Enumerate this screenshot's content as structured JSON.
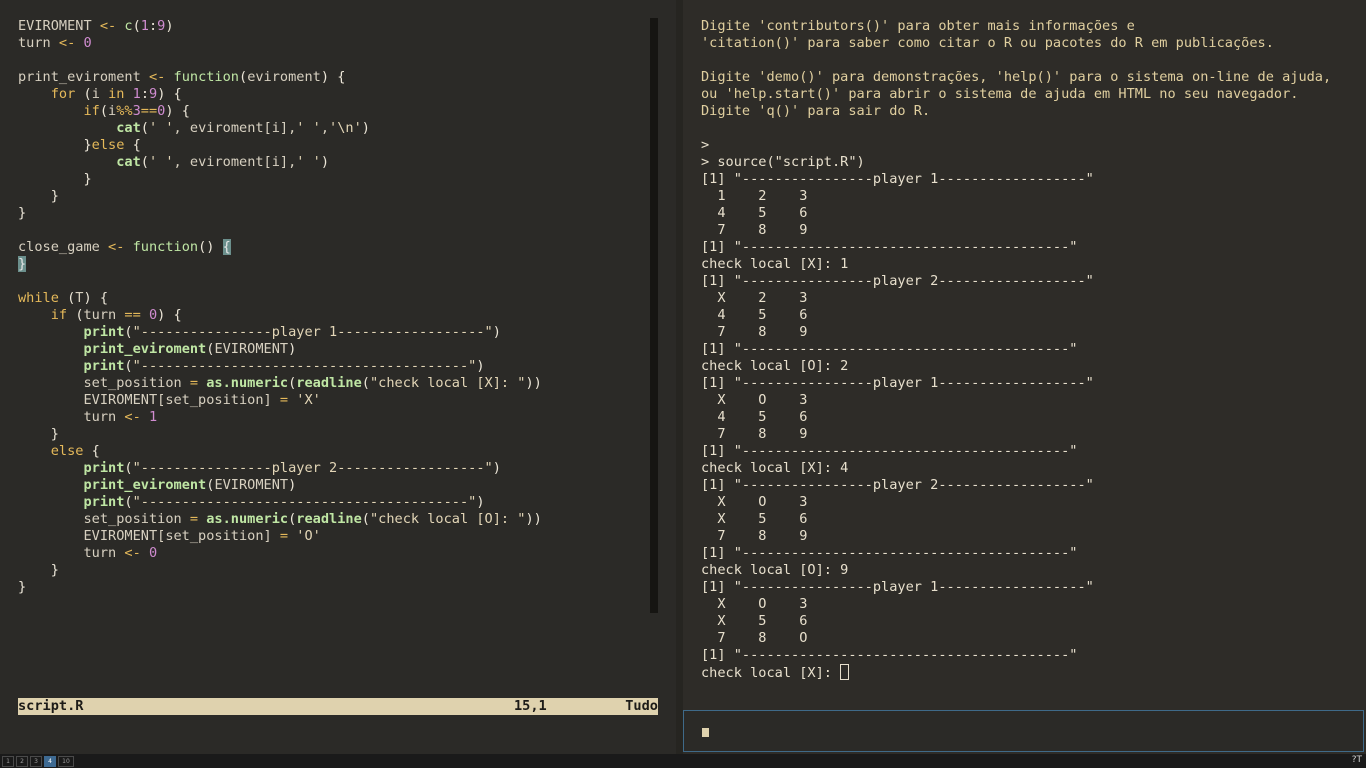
{
  "editor": {
    "code_lines": [
      [
        [
          "var",
          "EVIROMENT "
        ],
        [
          "op",
          "<- "
        ],
        [
          "fn",
          "c"
        ],
        [
          "br",
          "("
        ],
        [
          "num",
          "1"
        ],
        [
          "br",
          ":"
        ],
        [
          "num",
          "9"
        ],
        [
          "br",
          ")"
        ]
      ],
      [
        [
          "var",
          "turn "
        ],
        [
          "op",
          "<- "
        ],
        [
          "num",
          "0"
        ]
      ],
      [],
      [
        [
          "var",
          "print_eviroment "
        ],
        [
          "op",
          "<- "
        ],
        [
          "fn",
          "function"
        ],
        [
          "br",
          "("
        ],
        [
          "var",
          "eviroment"
        ],
        [
          "br",
          ") {"
        ]
      ],
      [
        [
          "var",
          "    "
        ],
        [
          "kw",
          "for "
        ],
        [
          "br",
          "("
        ],
        [
          "var",
          "i "
        ],
        [
          "kw",
          "in "
        ],
        [
          "num",
          "1"
        ],
        [
          "br",
          ":"
        ],
        [
          "num",
          "9"
        ],
        [
          "br",
          ") {"
        ]
      ],
      [
        [
          "var",
          "        "
        ],
        [
          "kw",
          "if"
        ],
        [
          "br",
          "("
        ],
        [
          "var",
          "i"
        ],
        [
          "op",
          "%%"
        ],
        [
          "num",
          "3"
        ],
        [
          "op",
          "=="
        ],
        [
          "num",
          "0"
        ],
        [
          "br",
          ") {"
        ]
      ],
      [
        [
          "var",
          "            "
        ],
        [
          "bfn",
          "cat"
        ],
        [
          "br",
          "("
        ],
        [
          "str",
          "' '"
        ],
        [
          "var",
          ", eviroment[i],"
        ],
        [
          "str",
          "' '"
        ],
        [
          "var",
          ","
        ],
        [
          "str",
          "'\\n'"
        ],
        [
          "br",
          ")"
        ]
      ],
      [
        [
          "var",
          "        "
        ],
        [
          "br",
          "}"
        ],
        [
          "kw",
          "else "
        ],
        [
          "br",
          "{"
        ]
      ],
      [
        [
          "var",
          "            "
        ],
        [
          "bfn",
          "cat"
        ],
        [
          "br",
          "("
        ],
        [
          "str",
          "' '"
        ],
        [
          "var",
          ", eviroment[i],"
        ],
        [
          "str",
          "' '"
        ],
        [
          "br",
          ")"
        ]
      ],
      [
        [
          "var",
          "        "
        ],
        [
          "br",
          "}"
        ]
      ],
      [
        [
          "var",
          "    "
        ],
        [
          "br",
          "}"
        ]
      ],
      [
        [
          "br",
          "}"
        ]
      ],
      [],
      [
        [
          "var",
          "close_game "
        ],
        [
          "op",
          "<- "
        ],
        [
          "fn",
          "function"
        ],
        [
          "br",
          "() "
        ],
        [
          "hl",
          "{"
        ]
      ],
      [
        [
          "hl",
          "}"
        ]
      ],
      [],
      [
        [
          "kw",
          "while "
        ],
        [
          "br",
          "("
        ],
        [
          "var",
          "T"
        ],
        [
          "br",
          ") {"
        ]
      ],
      [
        [
          "var",
          "    "
        ],
        [
          "kw",
          "if "
        ],
        [
          "br",
          "("
        ],
        [
          "var",
          "turn "
        ],
        [
          "op",
          "== "
        ],
        [
          "num",
          "0"
        ],
        [
          "br",
          ") {"
        ]
      ],
      [
        [
          "var",
          "        "
        ],
        [
          "bfn",
          "print"
        ],
        [
          "br",
          "("
        ],
        [
          "str",
          "\"----------------player 1------------------\""
        ],
        [
          "br",
          ")"
        ]
      ],
      [
        [
          "var",
          "        "
        ],
        [
          "bfn",
          "print_eviroment"
        ],
        [
          "br",
          "("
        ],
        [
          "var",
          "EVIROMENT"
        ],
        [
          "br",
          ")"
        ]
      ],
      [
        [
          "var",
          "        "
        ],
        [
          "bfn",
          "print"
        ],
        [
          "br",
          "("
        ],
        [
          "str",
          "\"----------------------------------------\""
        ],
        [
          "br",
          ")"
        ]
      ],
      [
        [
          "var",
          "        set_position "
        ],
        [
          "op",
          "= "
        ],
        [
          "bfn",
          "as.numeric"
        ],
        [
          "br",
          "("
        ],
        [
          "bfn",
          "readline"
        ],
        [
          "br",
          "("
        ],
        [
          "str",
          "\"check local [X]: \""
        ],
        [
          "br",
          "))"
        ]
      ],
      [
        [
          "var",
          "        EVIROMENT[set_position] "
        ],
        [
          "op",
          "= "
        ],
        [
          "str",
          "'X'"
        ]
      ],
      [
        [
          "var",
          "        turn "
        ],
        [
          "op",
          "<- "
        ],
        [
          "num",
          "1"
        ]
      ],
      [
        [
          "var",
          "    "
        ],
        [
          "br",
          "}"
        ]
      ],
      [
        [
          "var",
          "    "
        ],
        [
          "kw",
          "else "
        ],
        [
          "br",
          "{"
        ]
      ],
      [
        [
          "var",
          "        "
        ],
        [
          "bfn",
          "print"
        ],
        [
          "br",
          "("
        ],
        [
          "str",
          "\"----------------player 2------------------\""
        ],
        [
          "br",
          ")"
        ]
      ],
      [
        [
          "var",
          "        "
        ],
        [
          "bfn",
          "print_eviroment"
        ],
        [
          "br",
          "("
        ],
        [
          "var",
          "EVIROMENT"
        ],
        [
          "br",
          ")"
        ]
      ],
      [
        [
          "var",
          "        "
        ],
        [
          "bfn",
          "print"
        ],
        [
          "br",
          "("
        ],
        [
          "str",
          "\"----------------------------------------\""
        ],
        [
          "br",
          ")"
        ]
      ],
      [
        [
          "var",
          "        set_position "
        ],
        [
          "op",
          "= "
        ],
        [
          "bfn",
          "as.numeric"
        ],
        [
          "br",
          "("
        ],
        [
          "bfn",
          "readline"
        ],
        [
          "br",
          "("
        ],
        [
          "str",
          "\"check local [O]: \""
        ],
        [
          "br",
          "))"
        ]
      ],
      [
        [
          "var",
          "        EVIROMENT[set_position] "
        ],
        [
          "op",
          "= "
        ],
        [
          "str",
          "'O'"
        ]
      ],
      [
        [
          "var",
          "        turn "
        ],
        [
          "op",
          "<- "
        ],
        [
          "num",
          "0"
        ]
      ],
      [
        [
          "var",
          "    "
        ],
        [
          "br",
          "}"
        ]
      ],
      [
        [
          "br",
          "}"
        ]
      ]
    ],
    "status": {
      "filename": "script.R",
      "position": "15,1",
      "scope": "Tudo"
    }
  },
  "console": {
    "lines": [
      "Digite 'contributors()' para obter mais informações e",
      "'citation()' para saber como citar o R ou pacotes do R em publicações.",
      "",
      "Digite 'demo()' para demonstrações, 'help()' para o sistema on-line de ajuda,",
      "ou 'help.start()' para abrir o sistema de ajuda em HTML no seu navegador.",
      "Digite 'q()' para sair do R.",
      "",
      ">",
      "> source(\"script.R\")",
      "[1] \"----------------player 1------------------\"",
      "  1    2    3",
      "  4    5    6",
      "  7    8    9",
      "[1] \"----------------------------------------\"",
      "check local [X]: 1",
      "[1] \"----------------player 2------------------\"",
      "  X    2    3",
      "  4    5    6",
      "  7    8    9",
      "[1] \"----------------------------------------\"",
      "check local [O]: 2",
      "[1] \"----------------player 1------------------\"",
      "  X    O    3",
      "  4    5    6",
      "  7    8    9",
      "[1] \"----------------------------------------\"",
      "check local [X]: 4",
      "[1] \"----------------player 2------------------\"",
      "  X    O    3",
      "  X    5    6",
      "  7    8    9",
      "[1] \"----------------------------------------\"",
      "check local [O]: 9",
      "[1] \"----------------player 1------------------\"",
      "  X    O    3",
      "  X    5    6",
      "  7    8    O",
      "[1] \"----------------------------------------\""
    ],
    "prompt": "check local [X]: "
  },
  "taskbar": {
    "workspaces": [
      "1",
      "2",
      "3",
      "4",
      "10"
    ],
    "active_workspace": "4",
    "tray_text": "?T"
  },
  "colors": {
    "accent_border": "#3f6a89",
    "statusbar_bg": "#dfd2ae",
    "workspace_active": "#3e6a92"
  }
}
